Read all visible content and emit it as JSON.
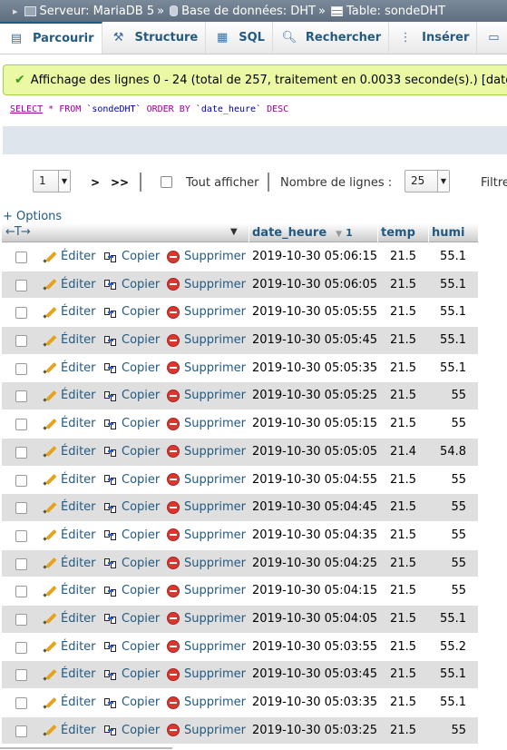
{
  "breadcrumb": {
    "server": "Serveur: MariaDB 5",
    "database": "Base de données: DHT",
    "table": "Table: sondeDHT",
    "separator": "»"
  },
  "tabs": [
    {
      "label": "Parcourir",
      "icon": "browse-icon",
      "active": true
    },
    {
      "label": "Structure",
      "icon": "structure-icon"
    },
    {
      "label": "SQL",
      "icon": "sql-icon"
    },
    {
      "label": "Rechercher",
      "icon": "search-icon"
    },
    {
      "label": "Insérer",
      "icon": "insert-icon"
    }
  ],
  "success_message": "Affichage des lignes 0 - 24 (total de 257, traitement en 0.0033 seconde(s).) [date",
  "sql": {
    "select": "SELECT",
    "star": "*",
    "from": "FROM",
    "table": "`sondeDHT`",
    "order_by": "ORDER BY",
    "column": "`date_heure`",
    "direction": "DESC"
  },
  "nav": {
    "page_value": "1",
    "next_label": ">",
    "last_label": ">>",
    "show_all_label": "Tout afficher",
    "rows_label": "Nombre de lignes :",
    "rows_value": "25",
    "filter_label": "Filtre"
  },
  "options_label": "+ Options",
  "columns": {
    "date_heure": "date_heure",
    "sort_index": "1",
    "temp": "temp",
    "humi": "humi"
  },
  "actions": {
    "edit": "Éditer",
    "copy": "Copier",
    "delete": "Supprimer"
  },
  "rows": [
    {
      "date_heure": "2019-10-30 05:06:15",
      "temp": "21.5",
      "humi": "55.1"
    },
    {
      "date_heure": "2019-10-30 05:06:05",
      "temp": "21.5",
      "humi": "55.1"
    },
    {
      "date_heure": "2019-10-30 05:05:55",
      "temp": "21.5",
      "humi": "55.1"
    },
    {
      "date_heure": "2019-10-30 05:05:45",
      "temp": "21.5",
      "humi": "55.1"
    },
    {
      "date_heure": "2019-10-30 05:05:35",
      "temp": "21.5",
      "humi": "55.1"
    },
    {
      "date_heure": "2019-10-30 05:05:25",
      "temp": "21.5",
      "humi": "55"
    },
    {
      "date_heure": "2019-10-30 05:05:15",
      "temp": "21.5",
      "humi": "55"
    },
    {
      "date_heure": "2019-10-30 05:05:05",
      "temp": "21.4",
      "humi": "54.8"
    },
    {
      "date_heure": "2019-10-30 05:04:55",
      "temp": "21.5",
      "humi": "55"
    },
    {
      "date_heure": "2019-10-30 05:04:45",
      "temp": "21.5",
      "humi": "55"
    },
    {
      "date_heure": "2019-10-30 05:04:35",
      "temp": "21.5",
      "humi": "55"
    },
    {
      "date_heure": "2019-10-30 05:04:25",
      "temp": "21.5",
      "humi": "55"
    },
    {
      "date_heure": "2019-10-30 05:04:15",
      "temp": "21.5",
      "humi": "55"
    },
    {
      "date_heure": "2019-10-30 05:04:05",
      "temp": "21.5",
      "humi": "55.1"
    },
    {
      "date_heure": "2019-10-30 05:03:55",
      "temp": "21.5",
      "humi": "55.2"
    },
    {
      "date_heure": "2019-10-30 05:03:45",
      "temp": "21.5",
      "humi": "55.1"
    },
    {
      "date_heure": "2019-10-30 05:03:35",
      "temp": "21.5",
      "humi": "55.1"
    },
    {
      "date_heure": "2019-10-30 05:03:25",
      "temp": "21.5",
      "humi": "55"
    }
  ]
}
